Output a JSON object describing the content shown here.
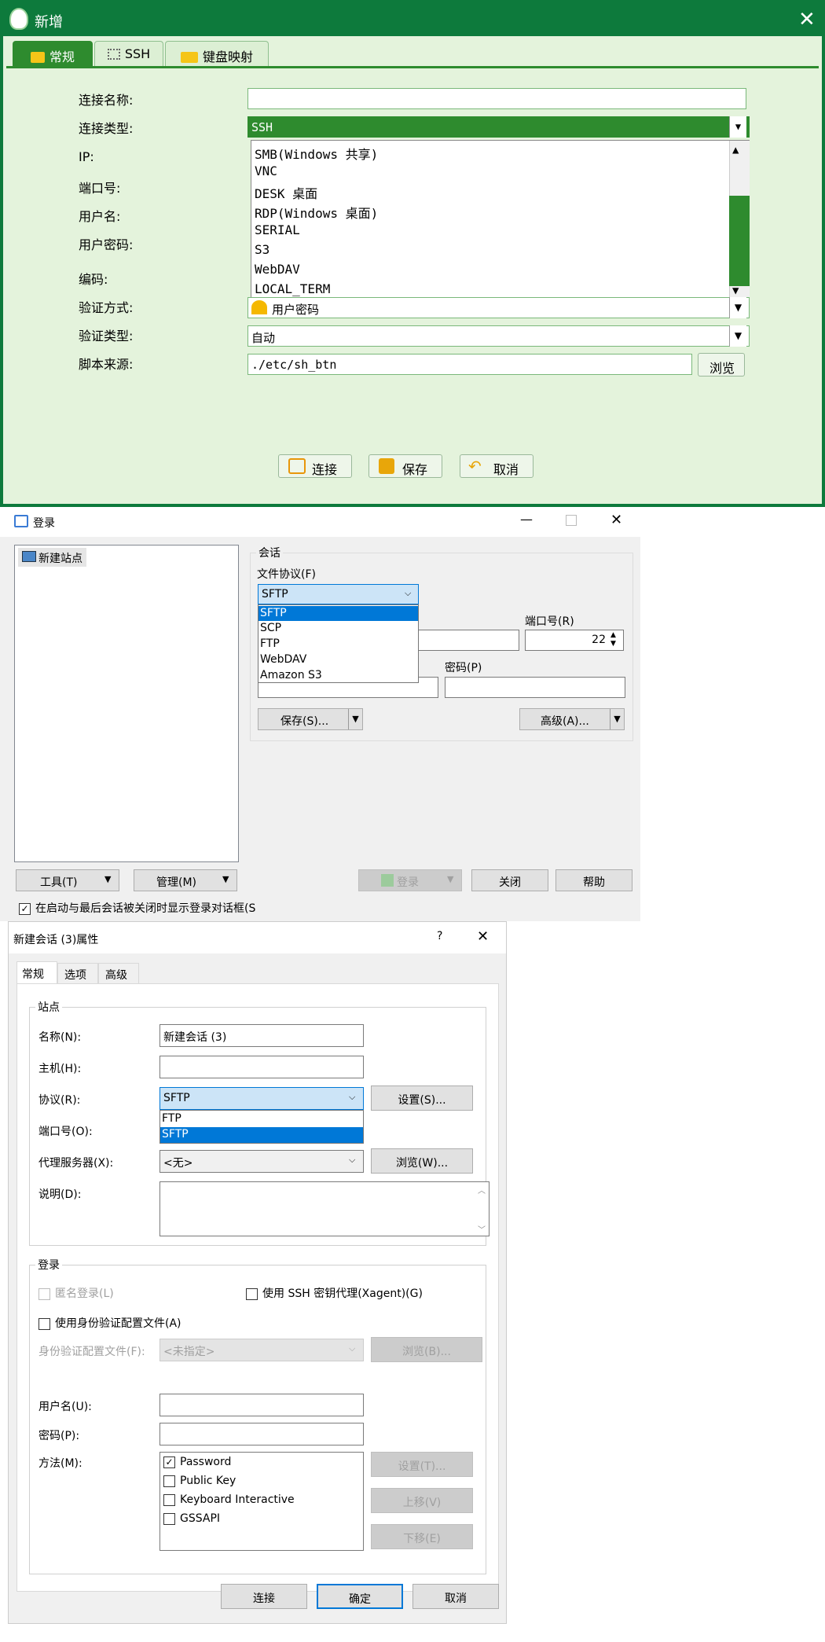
{
  "p1": {
    "title": "新增",
    "tabs": [
      "常规",
      "SSH",
      "键盘映射"
    ],
    "labels": [
      "连接名称:",
      "连接类型:",
      "IP:",
      "端口号:",
      "用户名:",
      "用户密码:",
      "编码:",
      "验证方式:",
      "验证类型:",
      "脚本来源:"
    ],
    "conn_name_value": "",
    "conn_type_value": "SSH",
    "dropdown_items": [
      "SMB(Windows 共享)",
      "VNC",
      "DESK 桌面",
      "RDP(Windows 桌面)",
      "SERIAL",
      "S3",
      "WebDAV",
      "LOCAL_TERM"
    ],
    "auth_method_value": "用户密码",
    "auth_type_value": "自动",
    "script_source_value": "./etc/sh_btn",
    "browse_label": "浏览",
    "buttons": [
      "连接",
      "保存",
      "取消"
    ],
    "colors": {
      "accent": "#0d7a3c",
      "bg": "#e4f3dc",
      "highlight": "#2e8b2e"
    }
  },
  "p2": {
    "title": "登录",
    "tree_item": "新建站点",
    "group_label": "会话",
    "protocol_label": "文件协议(F)",
    "protocol_value": "SFTP",
    "protocol_options": [
      "SFTP",
      "SCP",
      "FTP",
      "WebDAV",
      "Amazon S3"
    ],
    "port_label": "端口号(R)",
    "port_value": "22",
    "password_label": "密码(P)",
    "save_btn": "保存(S)...",
    "advanced_btn": "高级(A)...",
    "tools_btn": "工具(T)",
    "manage_btn": "管理(M)",
    "login_btn": "登录",
    "close_btn": "关闭",
    "help_btn": "帮助",
    "checkbox_label": "在启动与最后会话被关闭时显示登录对话框(S",
    "colors": {
      "selection": "#0078d7"
    }
  },
  "p3": {
    "title": "新建会话 (3)属性",
    "help": "?",
    "tabs": [
      "常规",
      "选项",
      "高级"
    ],
    "site_group": "站点",
    "name_label": "名称(N):",
    "name_value": "新建会话 (3)",
    "host_label": "主机(H):",
    "protocol_label": "协议(R):",
    "protocol_value": "SFTP",
    "protocol_options": [
      "FTP",
      "SFTP"
    ],
    "settings_btn": "设置(S)...",
    "port_label": "端口号(O):",
    "proxy_label": "代理服务器(X):",
    "proxy_value": "<无>",
    "browse_btn": "浏览(W)...",
    "desc_label": "说明(D):",
    "login_group": "登录",
    "anon_label": "匿名登录(L)",
    "agent_label": "使用 SSH 密钥代理(Xagent)(G)",
    "use_profile_label": "使用身份验证配置文件(A)",
    "profile_label": "身份验证配置文件(F):",
    "profile_value": "<未指定>",
    "profile_browse": "浏览(B)...",
    "user_label": "用户名(U):",
    "pass_label": "密码(P):",
    "method_label": "方法(M):",
    "methods": [
      "Password",
      "Public Key",
      "Keyboard Interactive",
      "GSSAPI"
    ],
    "method_settings": "设置(T)...",
    "move_up": "上移(V)",
    "move_down": "下移(E)",
    "connect_btn": "连接",
    "ok_btn": "确定",
    "cancel_btn": "取消"
  }
}
